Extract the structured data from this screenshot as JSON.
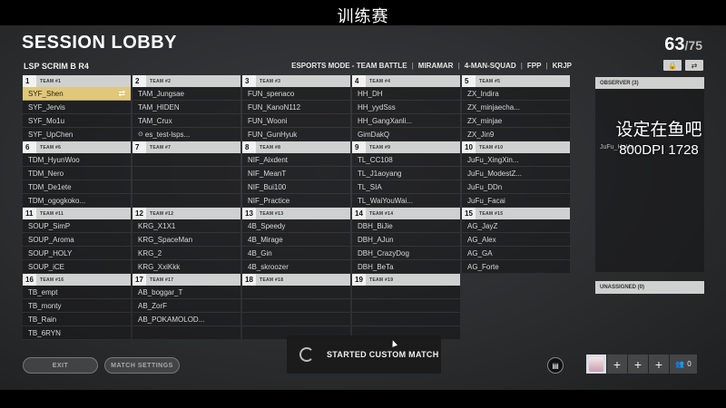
{
  "stream_title": "训练赛",
  "header": {
    "title": "SESSION LOBBY",
    "player_count": "63",
    "player_max": "/75",
    "lobby_name": "LSP SCRIM B R4",
    "mode": "ESPORTS MODE - TEAM BATTLE",
    "map": "MIRAMAR",
    "squad": "4-MAN-SQUAD",
    "perspective": "FPP",
    "region": "KRJP"
  },
  "teams": [
    {
      "num": "1",
      "label": "TEAM #1",
      "players": [
        "SYF_Shen",
        "SYF_Jervis",
        "SYF_Mo1u",
        "SYF_UpChen"
      ]
    },
    {
      "num": "2",
      "label": "TEAM #2",
      "players": [
        "TAM_Jungsae",
        "TAM_HIDEN",
        "TAM_Crux",
        "es_test-lsps..."
      ]
    },
    {
      "num": "3",
      "label": "TEAM #3",
      "players": [
        "FUN_spenaco",
        "FUN_KanoN112",
        "FUN_Wooni",
        "FUN_GunHyuk"
      ]
    },
    {
      "num": "4",
      "label": "TEAM #4",
      "players": [
        "HH_DH",
        "HH_yydSss",
        "HH_GangXanli...",
        "GimDakQ"
      ]
    },
    {
      "num": "5",
      "label": "TEAM #5",
      "players": [
        "ZX_Indira",
        "ZX_minjaecha...",
        "ZX_minjae",
        "ZX_Jin9"
      ]
    },
    {
      "num": "6",
      "label": "TEAM #6",
      "players": [
        "TDM_HyunWoo",
        "TDM_Nero",
        "TDM_De1ete",
        "TDM_ogogkoko..."
      ]
    },
    {
      "num": "7",
      "label": "TEAM #7",
      "players": [
        "",
        "",
        "",
        ""
      ]
    },
    {
      "num": "8",
      "label": "TEAM #8",
      "players": [
        "NIF_Aixdent",
        "NIF_MeanT",
        "NIF_Bui100",
        "NIF_Practice"
      ]
    },
    {
      "num": "9",
      "label": "TEAM #9",
      "players": [
        "TL_CC108",
        "TL_J1aoyang",
        "TL_SIA",
        "TL_WaiYouWai..."
      ]
    },
    {
      "num": "10",
      "label": "TEAM #10",
      "players": [
        "JuFu_XingXin...",
        "JuFu_ModestZ...",
        "JuFu_DDn",
        "JuFu_Facai"
      ]
    },
    {
      "num": "11",
      "label": "TEAM #11",
      "players": [
        "SOUP_SimP",
        "SOUP_Aroma",
        "SOUP_HOLY",
        "SOUP_iCE"
      ]
    },
    {
      "num": "12",
      "label": "TEAM #12",
      "players": [
        "KRG_X1X1",
        "KRG_SpaceMan",
        "KRG_2",
        "KRG_XxiKkk"
      ]
    },
    {
      "num": "13",
      "label": "TEAM #13",
      "players": [
        "4B_Speedy",
        "4B_Mirage",
        "4B_Gin",
        "4B_skroozer"
      ]
    },
    {
      "num": "14",
      "label": "TEAM #14",
      "players": [
        "DBH_BiJie",
        "DBH_AJun",
        "DBH_CrazyDog",
        "DBH_BeTa"
      ]
    },
    {
      "num": "15",
      "label": "TEAM #15",
      "players": [
        "AG_JayZ",
        "AG_Alex",
        "AG_GA",
        "AG_Forte"
      ]
    },
    {
      "num": "16",
      "label": "TEAM #16",
      "players": [
        "TB_empt",
        "TB_monty",
        "TB_Rain",
        "TB_6RYN"
      ]
    },
    {
      "num": "17",
      "label": "TEAM #17",
      "players": [
        "AB_boggar_T",
        "AB_ZorF",
        "AB_POKAMOLOD...",
        ""
      ]
    },
    {
      "num": "18",
      "label": "TEAM #18",
      "players": [
        "",
        "",
        "",
        ""
      ]
    },
    {
      "num": "19",
      "label": "TEAM #19",
      "players": [
        "",
        "",
        "",
        ""
      ]
    }
  ],
  "observer": {
    "label": "OBSERVER (3)",
    "items": [
      "JuFu_HaHa"
    ]
  },
  "unassigned": {
    "label": "UNASSIGNED (0)"
  },
  "overlay": {
    "line1": "设定在鱼吧",
    "line2": "800DPI 1728"
  },
  "buttons": {
    "exit": "EXIT",
    "match_settings": "MATCH SETTINGS"
  },
  "toast": {
    "text": "STARTED CUSTOM MATCH"
  },
  "squad_bar": {
    "count": "0"
  }
}
